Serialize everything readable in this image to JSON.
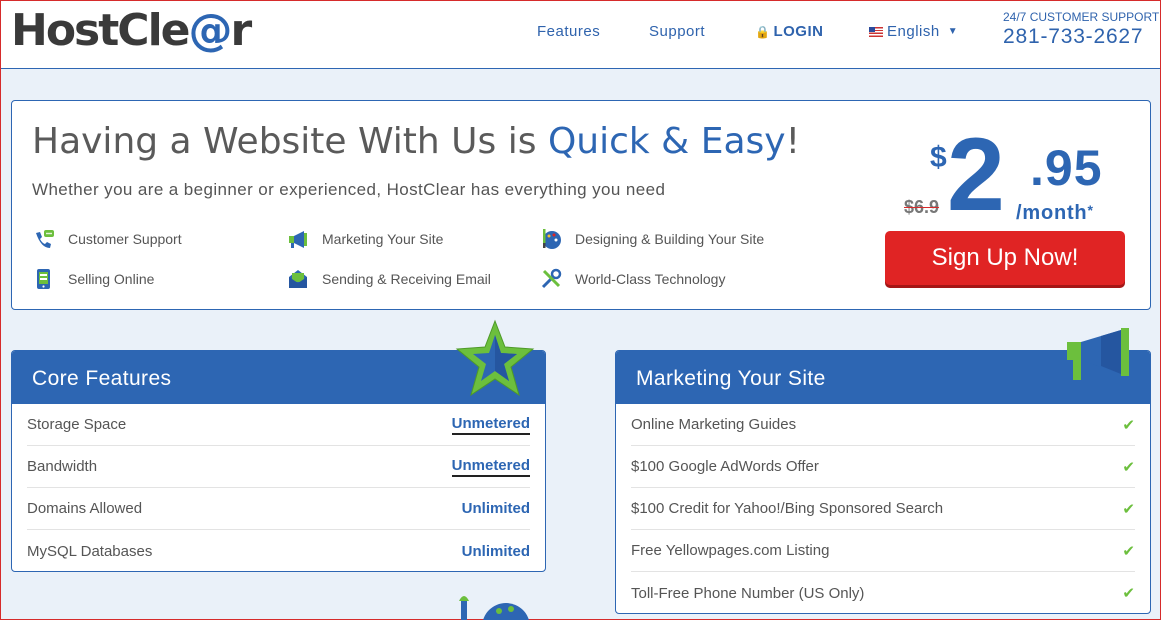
{
  "header": {
    "logo_main": "HostCle",
    "logo_at": "@",
    "logo_end": "r",
    "nav": {
      "features": "Features",
      "support": "Support",
      "login": "LOGIN",
      "language": "English"
    },
    "support_label": "24/7 CUSTOMER SUPPORT",
    "support_phone": "281-733-2627"
  },
  "hero": {
    "title_plain": "Having a Website With Us is ",
    "title_highlight": "Quick & Easy",
    "title_end": "!",
    "subtitle": "Whether you are a beginner or experienced, HostClear has everything you need",
    "features": [
      {
        "label": "Customer Support",
        "icon": "phone-chat-icon"
      },
      {
        "label": "Marketing Your Site",
        "icon": "megaphone-icon"
      },
      {
        "label": "Designing & Building Your Site",
        "icon": "palette-icon"
      },
      {
        "label": "Selling Online",
        "icon": "mobile-store-icon"
      },
      {
        "label": "Sending & Receiving Email",
        "icon": "envelope-icon"
      },
      {
        "label": "World-Class Technology",
        "icon": "tools-icon"
      }
    ],
    "price": {
      "currency": "$",
      "whole": "2",
      "cents": ".95",
      "old": "$6.9",
      "period": "/month",
      "asterisk": "*"
    },
    "cta": "Sign Up Now!"
  },
  "core_features": {
    "title": "Core Features",
    "rows": [
      {
        "label": "Storage Space",
        "value": "Unmetered"
      },
      {
        "label": "Bandwidth",
        "value": "Unmetered"
      },
      {
        "label": "Domains Allowed",
        "value": "Unlimited"
      },
      {
        "label": "MySQL Databases",
        "value": "Unlimited"
      }
    ]
  },
  "marketing": {
    "title": "Marketing Your Site",
    "rows": [
      "Online Marketing Guides",
      "$100 Google AdWords Offer",
      "$100 Credit for Yahoo!/Bing Sponsored Search",
      "Free Yellowpages.com Listing",
      "Toll-Free Phone Number (US Only)"
    ]
  },
  "colors": {
    "brand_blue": "#2d66b3",
    "cta_red": "#e02424",
    "check_green": "#6cbf3d"
  }
}
